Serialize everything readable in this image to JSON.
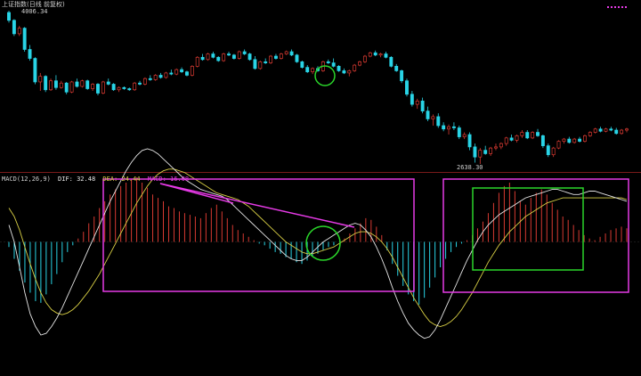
{
  "main_panel": {
    "title": "上证指数(日线 前复权)",
    "high_label": "4006.34",
    "low_label": "2638.30"
  },
  "macd_panel": {
    "name": "MACD(12,26,9)",
    "dif_label": "DIF: 32.48",
    "dea_label": "DEA: 24.44",
    "macd_label": "MACD: 16.08"
  },
  "colors": {
    "background": "#000000",
    "up": "#d83a32",
    "down": "#29d4e6",
    "dif_line": "#e6e6e6",
    "dea_line": "#d8cf45",
    "annotation_magenta": "#e63ae6",
    "annotation_green": "#2ad52a",
    "separator": "#7a1a1a"
  },
  "chart_data": [
    {
      "type": "candlestick",
      "title": "上证指数(日线 前复权)",
      "annotations": [
        "4006.34",
        "2638.30"
      ],
      "ohlc": [
        [
          3990,
          4006,
          3900,
          3920
        ],
        [
          3920,
          3930,
          3780,
          3800
        ],
        [
          3800,
          3870,
          3780,
          3850
        ],
        [
          3850,
          3860,
          3640,
          3660
        ],
        [
          3660,
          3700,
          3560,
          3580
        ],
        [
          3580,
          3590,
          3350,
          3370
        ],
        [
          3370,
          3450,
          3290,
          3420
        ],
        [
          3420,
          3430,
          3280,
          3300
        ],
        [
          3300,
          3400,
          3290,
          3380
        ],
        [
          3380,
          3430,
          3300,
          3320
        ],
        [
          3320,
          3380,
          3310,
          3360
        ],
        [
          3360,
          3370,
          3260,
          3280
        ],
        [
          3280,
          3380,
          3270,
          3370
        ],
        [
          3370,
          3400,
          3320,
          3330
        ],
        [
          3330,
          3390,
          3320,
          3380
        ],
        [
          3380,
          3390,
          3300,
          3310
        ],
        [
          3310,
          3360,
          3290,
          3350
        ],
        [
          3350,
          3360,
          3250,
          3270
        ],
        [
          3270,
          3380,
          3260,
          3370
        ],
        [
          3370,
          3400,
          3340,
          3350
        ],
        [
          3350,
          3360,
          3290,
          3300
        ],
        [
          3300,
          3330,
          3280,
          3320
        ],
        [
          3320,
          3330,
          3300,
          3310
        ],
        [
          3310,
          3320,
          3290,
          3300
        ],
        [
          3300,
          3370,
          3290,
          3360
        ],
        [
          3360,
          3380,
          3340,
          3350
        ],
        [
          3350,
          3410,
          3340,
          3400
        ],
        [
          3400,
          3430,
          3380,
          3390
        ],
        [
          3390,
          3440,
          3380,
          3430
        ],
        [
          3430,
          3450,
          3400,
          3410
        ],
        [
          3410,
          3460,
          3400,
          3450
        ],
        [
          3450,
          3480,
          3430,
          3440
        ],
        [
          3440,
          3490,
          3430,
          3480
        ],
        [
          3480,
          3500,
          3450,
          3460
        ],
        [
          3460,
          3470,
          3420,
          3430
        ],
        [
          3430,
          3520,
          3420,
          3510
        ],
        [
          3510,
          3600,
          3500,
          3590
        ],
        [
          3590,
          3620,
          3560,
          3570
        ],
        [
          3570,
          3630,
          3560,
          3620
        ],
        [
          3620,
          3640,
          3580,
          3590
        ],
        [
          3590,
          3600,
          3550,
          3560
        ],
        [
          3560,
          3630,
          3550,
          3620
        ],
        [
          3620,
          3640,
          3600,
          3610
        ],
        [
          3610,
          3620,
          3570,
          3580
        ],
        [
          3580,
          3650,
          3570,
          3640
        ],
        [
          3640,
          3660,
          3610,
          3620
        ],
        [
          3620,
          3630,
          3560,
          3570
        ],
        [
          3570,
          3600,
          3480,
          3490
        ],
        [
          3490,
          3560,
          3480,
          3550
        ],
        [
          3550,
          3580,
          3530,
          3540
        ],
        [
          3540,
          3610,
          3530,
          3600
        ],
        [
          3600,
          3620,
          3570,
          3580
        ],
        [
          3580,
          3630,
          3570,
          3620
        ],
        [
          3620,
          3650,
          3610,
          3640
        ],
        [
          3640,
          3660,
          3600,
          3610
        ],
        [
          3610,
          3620,
          3540,
          3550
        ],
        [
          3550,
          3560,
          3490,
          3500
        ],
        [
          3500,
          3520,
          3450,
          3460
        ],
        [
          3460,
          3500,
          3440,
          3490
        ],
        [
          3490,
          3510,
          3460,
          3470
        ],
        [
          3470,
          3560,
          3460,
          3550
        ],
        [
          3550,
          3570,
          3530,
          3540
        ],
        [
          3540,
          3580,
          3500,
          3510
        ],
        [
          3510,
          3520,
          3460,
          3470
        ],
        [
          3470,
          3490,
          3440,
          3450
        ],
        [
          3450,
          3480,
          3420,
          3470
        ],
        [
          3470,
          3530,
          3460,
          3520
        ],
        [
          3520,
          3560,
          3510,
          3550
        ],
        [
          3550,
          3610,
          3540,
          3600
        ],
        [
          3600,
          3640,
          3590,
          3630
        ],
        [
          3630,
          3650,
          3600,
          3610
        ],
        [
          3610,
          3630,
          3590,
          3620
        ],
        [
          3620,
          3640,
          3580,
          3590
        ],
        [
          3590,
          3600,
          3500,
          3510
        ],
        [
          3510,
          3530,
          3460,
          3470
        ],
        [
          3470,
          3480,
          3360,
          3380
        ],
        [
          3380,
          3400,
          3240,
          3260
        ],
        [
          3260,
          3290,
          3150,
          3170
        ],
        [
          3170,
          3220,
          3130,
          3200
        ],
        [
          3200,
          3230,
          3090,
          3110
        ],
        [
          3110,
          3150,
          3020,
          3040
        ],
        [
          3040,
          3080,
          2980,
          3060
        ],
        [
          3060,
          3090,
          2960,
          2980
        ],
        [
          2980,
          3010,
          2930,
          2950
        ],
        [
          2950,
          2990,
          2900,
          2970
        ],
        [
          2970,
          3010,
          2940,
          2960
        ],
        [
          2960,
          2980,
          2860,
          2880
        ],
        [
          2880,
          2920,
          2860,
          2900
        ],
        [
          2900,
          2920,
          2760,
          2790
        ],
        [
          2790,
          2820,
          2650,
          2700
        ],
        [
          2700,
          2780,
          2638,
          2760
        ],
        [
          2760,
          2800,
          2720,
          2730
        ],
        [
          2730,
          2790,
          2710,
          2780
        ],
        [
          2780,
          2820,
          2760,
          2790
        ],
        [
          2790,
          2830,
          2770,
          2820
        ],
        [
          2820,
          2880,
          2800,
          2870
        ],
        [
          2870,
          2900,
          2840,
          2850
        ],
        [
          2850,
          2900,
          2830,
          2890
        ],
        [
          2890,
          2940,
          2870,
          2920
        ],
        [
          2920,
          2940,
          2860,
          2870
        ],
        [
          2870,
          2930,
          2860,
          2920
        ],
        [
          2920,
          2950,
          2880,
          2890
        ],
        [
          2890,
          2900,
          2780,
          2800
        ],
        [
          2800,
          2820,
          2700,
          2720
        ],
        [
          2720,
          2790,
          2700,
          2780
        ],
        [
          2780,
          2850,
          2770,
          2840
        ],
        [
          2840,
          2870,
          2820,
          2860
        ],
        [
          2860,
          2880,
          2820,
          2830
        ],
        [
          2830,
          2870,
          2820,
          2860
        ],
        [
          2860,
          2880,
          2830,
          2840
        ],
        [
          2840,
          2900,
          2830,
          2890
        ],
        [
          2890,
          2930,
          2880,
          2920
        ],
        [
          2920,
          2960,
          2910,
          2950
        ],
        [
          2950,
          2970,
          2920,
          2930
        ],
        [
          2930,
          2960,
          2920,
          2950
        ],
        [
          2950,
          2970,
          2930,
          2940
        ],
        [
          2940,
          2960,
          2900,
          2910
        ],
        [
          2910,
          2950,
          2900,
          2940
        ],
        [
          2940,
          2960,
          2920,
          2950
        ]
      ]
    },
    {
      "type": "bar",
      "title": "MACD(12,26,9)",
      "series": [
        {
          "name": "MACD: 16.08",
          "values": [
            -6,
            -20,
            -34,
            -48,
            -60,
            -70,
            -72,
            -62,
            -50,
            -38,
            -24,
            -12,
            -4,
            4,
            12,
            22,
            30,
            40,
            48,
            56,
            62,
            66,
            70,
            74,
            76,
            70,
            64,
            56,
            52,
            48,
            42,
            40,
            36,
            34,
            32,
            30,
            28,
            34,
            40,
            44,
            36,
            28,
            20,
            14,
            10,
            6,
            2,
            -2,
            -4,
            -8,
            -12,
            -14,
            -18,
            -20,
            -24,
            -26,
            -22,
            -18,
            -14,
            -10,
            -6,
            -4,
            0,
            4,
            10,
            16,
            22,
            28,
            26,
            18,
            8,
            -10,
            -26,
            -40,
            -52,
            -62,
            -70,
            -74,
            -66,
            -54,
            -42,
            -30,
            -20,
            -12,
            -6,
            -2,
            2,
            8,
            16,
            24,
            34,
            46,
            58,
            66,
            70,
            60,
            48,
            44,
            52,
            58,
            62,
            56,
            46,
            38,
            30,
            26,
            20,
            14,
            8,
            4,
            2,
            6,
            10,
            14,
            16,
            18,
            16
          ]
        }
      ]
    },
    {
      "type": "line",
      "series": [
        {
          "name": "DIF: 32.48",
          "values": [
            20,
            0,
            -30,
            -60,
            -85,
            -100,
            -110,
            -108,
            -100,
            -90,
            -78,
            -64,
            -50,
            -36,
            -22,
            -8,
            6,
            20,
            34,
            48,
            60,
            72,
            84,
            94,
            102,
            108,
            110,
            108,
            104,
            98,
            92,
            86,
            80,
            74,
            70,
            66,
            62,
            60,
            58,
            56,
            54,
            50,
            44,
            38,
            32,
            26,
            20,
            14,
            8,
            2,
            -4,
            -10,
            -16,
            -20,
            -22,
            -22,
            -18,
            -12,
            -6,
            0,
            4,
            8,
            12,
            16,
            20,
            22,
            20,
            14,
            6,
            -6,
            -20,
            -36,
            -54,
            -70,
            -84,
            -96,
            -104,
            -110,
            -114,
            -112,
            -104,
            -92,
            -78,
            -64,
            -50,
            -36,
            -22,
            -10,
            2,
            12,
            20,
            26,
            32,
            36,
            40,
            44,
            48,
            52,
            54,
            56,
            58,
            60,
            62,
            62,
            60,
            58,
            56,
            56,
            58,
            60,
            60,
            58,
            56,
            54,
            52,
            50,
            48
          ]
        },
        {
          "name": "DEA: 24.44",
          "values": [
            40,
            30,
            14,
            -6,
            -26,
            -44,
            -60,
            -72,
            -80,
            -84,
            -86,
            -84,
            -80,
            -74,
            -66,
            -58,
            -48,
            -38,
            -26,
            -14,
            -2,
            10,
            22,
            34,
            46,
            56,
            66,
            74,
            80,
            84,
            86,
            86,
            84,
            82,
            78,
            74,
            70,
            66,
            62,
            58,
            56,
            54,
            52,
            50,
            46,
            42,
            36,
            30,
            24,
            18,
            12,
            6,
            0,
            -4,
            -8,
            -12,
            -14,
            -14,
            -12,
            -10,
            -8,
            -6,
            -2,
            2,
            6,
            10,
            12,
            12,
            10,
            6,
            0,
            -8,
            -18,
            -30,
            -42,
            -54,
            -66,
            -76,
            -86,
            -94,
            -98,
            -100,
            -98,
            -94,
            -88,
            -80,
            -70,
            -60,
            -48,
            -36,
            -24,
            -14,
            -4,
            4,
            12,
            18,
            24,
            30,
            34,
            38,
            42,
            46,
            48,
            50,
            52,
            52,
            52,
            52,
            52,
            52,
            52,
            52,
            52,
            52,
            52,
            52,
            50
          ]
        }
      ]
    }
  ]
}
